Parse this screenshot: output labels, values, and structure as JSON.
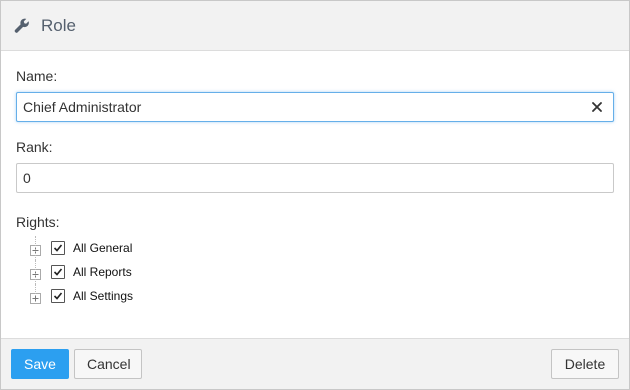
{
  "header": {
    "title": "Role",
    "icon": "wrench-icon"
  },
  "fields": {
    "name": {
      "label": "Name:",
      "value": "Chief Administrator"
    },
    "rank": {
      "label": "Rank:",
      "value": "0"
    }
  },
  "rights": {
    "label": "Rights:",
    "items": [
      {
        "label": "All General",
        "checked": true
      },
      {
        "label": "All Reports",
        "checked": true
      },
      {
        "label": "All Settings",
        "checked": true
      }
    ]
  },
  "footer": {
    "save_label": "Save",
    "cancel_label": "Cancel",
    "delete_label": "Delete"
  },
  "colors": {
    "primary": "#2c9ff0",
    "focus": "#66afe9",
    "header_bg": "#f2f2f2"
  }
}
